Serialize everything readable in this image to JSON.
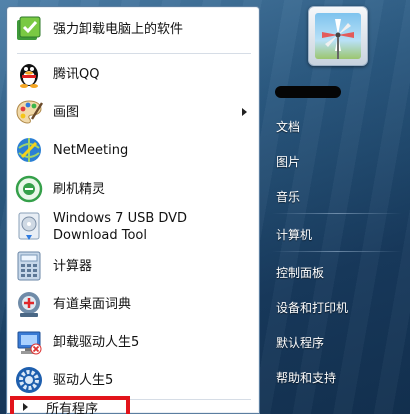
{
  "programs": [
    {
      "label": "强力卸载电脑上的软件",
      "icon": "uninstaller-icon"
    },
    {
      "label": "腾讯QQ",
      "icon": "qq-penguin-icon"
    },
    {
      "label": "画图",
      "icon": "paint-palette-icon"
    },
    {
      "label": "NetMeeting",
      "icon": "netmeeting-icon"
    },
    {
      "label": "刷机精灵",
      "icon": "flash-wizard-icon"
    },
    {
      "label_line1": "Windows 7 USB DVD",
      "label_line2": "Download Tool",
      "icon": "usb-dvd-tool-icon"
    },
    {
      "label": "计算器",
      "icon": "calculator-icon"
    },
    {
      "label": "有道桌面词典",
      "icon": "youdao-dictionary-icon"
    },
    {
      "label": "卸载驱动人生5",
      "icon": "uninstall-driver-icon"
    },
    {
      "label": "驱动人生5",
      "icon": "driver-gear-icon"
    }
  ],
  "all_programs": "所有程序",
  "right_links": [
    "文档",
    "图片",
    "音乐",
    "计算机",
    "控制面板",
    "设备和打印机",
    "默认程序",
    "帮助和支持"
  ],
  "colors": {
    "highlight": "#e2141b",
    "panel_bg": "#ffffff",
    "glass": "#2a587f"
  }
}
